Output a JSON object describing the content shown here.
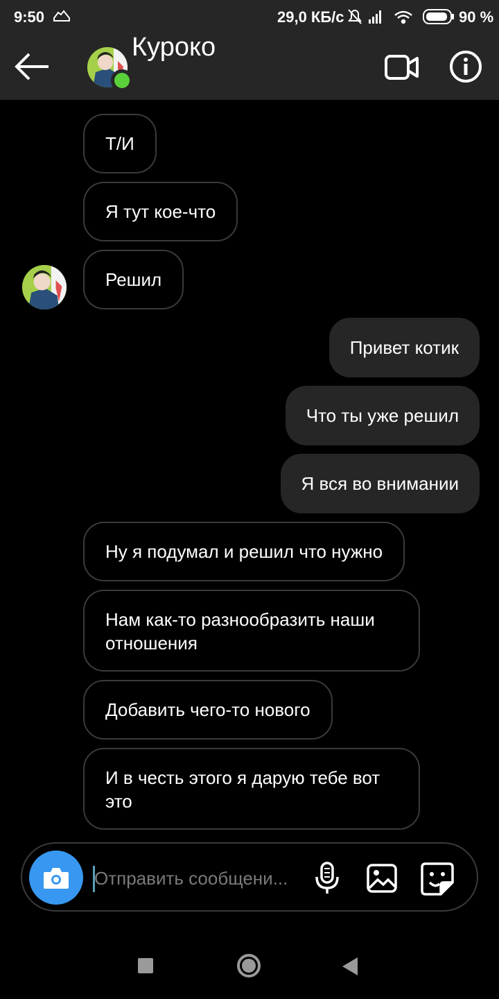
{
  "status_bar": {
    "time": "9:50",
    "network_speed": "29,0 КБ/с",
    "battery": "90 %"
  },
  "header": {
    "contact_name": "Куроко",
    "icons": [
      "back-arrow-icon",
      "video-call-icon",
      "info-icon"
    ],
    "online": true
  },
  "messages": [
    {
      "text": "Т/И",
      "direction": "incoming"
    },
    {
      "text": "Я тут кое-что",
      "direction": "incoming"
    },
    {
      "text": "Решил",
      "direction": "incoming"
    },
    {
      "text": "Привет котик",
      "direction": "outgoing"
    },
    {
      "text": "Что ты уже решил",
      "direction": "outgoing"
    },
    {
      "text": "Я вся во внимании",
      "direction": "outgoing"
    },
    {
      "text": "Ну я подумал и решил что нужно",
      "direction": "incoming"
    },
    {
      "text": "Нам как-то разнообразить наши отношения",
      "direction": "incoming"
    },
    {
      "text": "Добавить чего-то нового",
      "direction": "incoming"
    },
    {
      "text": "И в честь этого я дарую тебе вот это",
      "direction": "incoming"
    }
  ],
  "composer": {
    "placeholder": "Отправить сообщени...",
    "value": "",
    "icons": [
      "camera-icon",
      "microphone-icon",
      "gallery-icon",
      "sticker-icon"
    ]
  },
  "colors": {
    "accent": "#3897f0",
    "online": "#5ad13b",
    "header_bg": "#262626",
    "background": "#000000"
  }
}
